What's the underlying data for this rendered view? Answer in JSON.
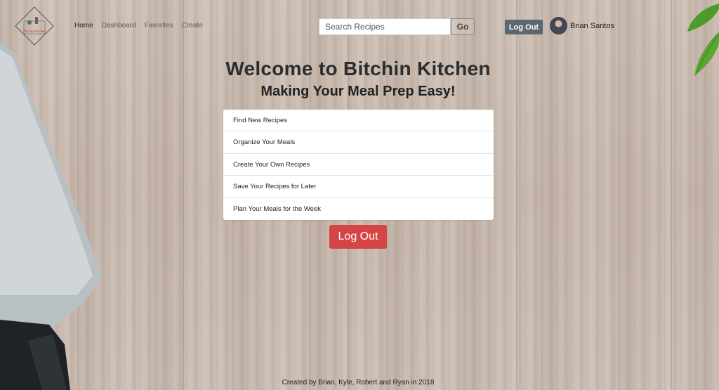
{
  "nav": {
    "logo_text": "Bitchin Kitchen",
    "items": [
      "Home",
      "Dashboard",
      "Favorites",
      "Create"
    ]
  },
  "search": {
    "placeholder": "Search Recipes",
    "button_label": "Go"
  },
  "header": {
    "logout_label": "Log Out",
    "user_name": "Brian Santos"
  },
  "hero": {
    "title": "Welcome to Bitchin Kitchen",
    "subtitle": "Making Your Meal Prep Easy!"
  },
  "features": [
    "Find New Recipes",
    "Organize Your Meals",
    "Create Your Own Recipes",
    "Save Your Recipes for Later",
    "Plan Your Meals for the Week"
  ],
  "main": {
    "logout_label": "Log Out"
  },
  "footer": {
    "text": "Created by Brian, Kyle, Robert and Ryan in 2018"
  },
  "colors": {
    "logout_primary": "#d64545",
    "logout_header": "#5c6770",
    "wood_background": "#c9bbb0"
  }
}
